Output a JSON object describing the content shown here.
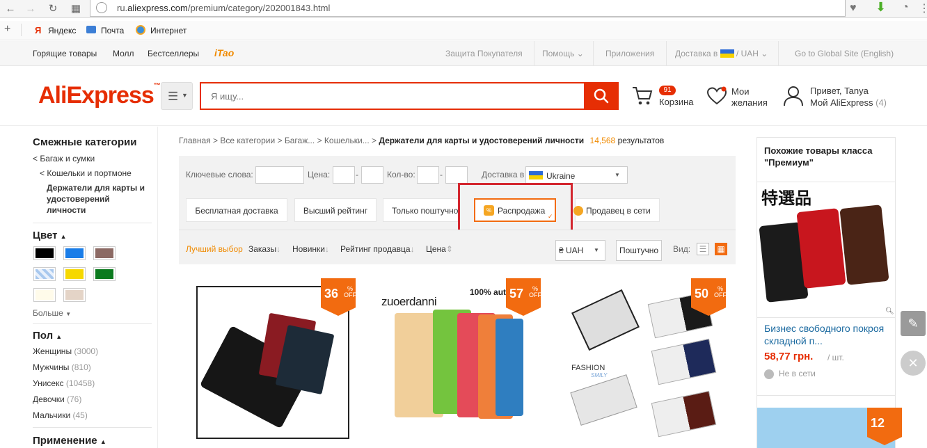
{
  "browser": {
    "url_prefix": "ru.",
    "url_domain": "aliexpress.com",
    "url_path": "/premium/category/202001843.html",
    "bookmarks": [
      "Яндекс",
      "Почта",
      "Интернет"
    ]
  },
  "topnav": {
    "left": [
      "Горящие товары",
      "Молл",
      "Бестселлеры"
    ],
    "itao": "iTao",
    "buyer_protection": "Защита Покупателя",
    "help": "Помощь",
    "apps": "Приложения",
    "ship_to": "Доставка в",
    "currency": "UAH",
    "global_site": "Go to Global Site (English)"
  },
  "header": {
    "logo": "AliExpress",
    "search_placeholder": "Я ищу...",
    "cart_count": "91",
    "cart_label": "Корзина",
    "wishlist_line1": "Мои",
    "wishlist_line2": "желания",
    "greeting": "Привет, Tanya",
    "my_ali": "Мой AliExpress",
    "my_ali_count": "(4)"
  },
  "sidebar": {
    "related_title": "Смежные категории",
    "cat1": "< Багаж и сумки",
    "cat2": "< Кошельки и портмоне",
    "cat3_lines": [
      "Держатели для карты и",
      "удостоверений",
      "личности"
    ],
    "color_title": "Цвет",
    "colors": [
      "#000000",
      "#1a7de8",
      "#8c6a64",
      "#a8c8ee",
      "#f6d800",
      "#0b7a1e",
      "#fffbea",
      "#e4d4c7"
    ],
    "more": "Больше",
    "gender_title": "Пол",
    "genders": [
      {
        "label": "Женщины",
        "count": "(3000)"
      },
      {
        "label": "Мужчины",
        "count": "(810)"
      },
      {
        "label": "Унисекс",
        "count": "(10458)"
      },
      {
        "label": "Девочки",
        "count": "(76)"
      },
      {
        "label": "Мальчики",
        "count": "(45)"
      }
    ],
    "usage_title": "Применение"
  },
  "breadcrumb": {
    "path": "Главная > Все категории > Багаж... > Кошельки... >",
    "current": "Держатели для карты и удостоверений личности",
    "count": "14,568",
    "results": "результатов"
  },
  "filters": {
    "keywords": "Ключевые слова:",
    "price": "Цена:",
    "qty": "Кол-во:",
    "ship_to": "Доставка в",
    "country": "Ukraine",
    "dash": "-",
    "chips": [
      "Бесплатная доставка",
      "Высший рейтинг",
      "Только поштучно",
      "Распродажа",
      "Продавец в сети"
    ]
  },
  "sort": {
    "best": "Лучший выбор",
    "orders": "Заказы",
    "new": "Новинки",
    "seller_rating": "Рейтинг продавца",
    "price": "Цена",
    "currency": "₴ UAH",
    "per_piece": "Поштучно",
    "view": "Вид:"
  },
  "products": [
    {
      "discount": "36",
      "pct": "%",
      "off": "OFF"
    },
    {
      "discount": "57",
      "pct": "%",
      "off": "OFF",
      "brand": "zuoerdanni",
      "tag": "100% aut"
    },
    {
      "discount": "50",
      "pct": "%",
      "off": "OFF",
      "caption1": "FASHION",
      "caption2": "SMILY"
    }
  ],
  "premium": {
    "title": "Похожие товары класса \"Премиум\"",
    "img_text": "特選品",
    "item_line1": "Бизнес свободного покроя",
    "item_line2": "складной п...",
    "price": "58,77 грн.",
    "unit": "/ шт.",
    "offline": "Не в сети",
    "next_discount": "12"
  }
}
